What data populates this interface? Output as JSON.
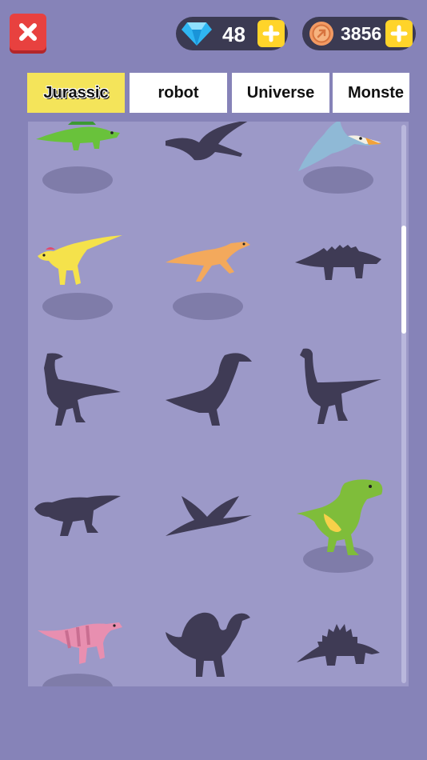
{
  "header": {
    "gems": "48",
    "coins": "3856"
  },
  "tabs": [
    {
      "label": "Jurassic",
      "active": true
    },
    {
      "label": "robot",
      "active": false
    },
    {
      "label": "Universe",
      "active": false
    },
    {
      "label": "Monste",
      "active": false
    }
  ],
  "colors": {
    "background": "#8683b8",
    "panel": "#9c99c8",
    "silhouette": "#3f3b55",
    "close": "#e8413f",
    "plus": "#ffd42a",
    "activeTab": "#f4e45a"
  },
  "collection": [
    {
      "slot": "spinosaur-green",
      "unlocked": true
    },
    {
      "slot": "pterosaur-1",
      "unlocked": false
    },
    {
      "slot": "pteranodon-blue",
      "unlocked": true
    },
    {
      "slot": "dilophosaur-yellow",
      "unlocked": true
    },
    {
      "slot": "raptor-orange",
      "unlocked": true
    },
    {
      "slot": "ankylosaur",
      "unlocked": false
    },
    {
      "slot": "theropod-1",
      "unlocked": false
    },
    {
      "slot": "parasaurolophus",
      "unlocked": false
    },
    {
      "slot": "ornithomimus",
      "unlocked": false
    },
    {
      "slot": "carnotaurus",
      "unlocked": false
    },
    {
      "slot": "pterosaur-2",
      "unlocked": false
    },
    {
      "slot": "trex-green",
      "unlocked": true
    },
    {
      "slot": "iguanodon-pink",
      "unlocked": true
    },
    {
      "slot": "spinosaurus",
      "unlocked": false
    },
    {
      "slot": "stegosaur",
      "unlocked": false
    }
  ]
}
